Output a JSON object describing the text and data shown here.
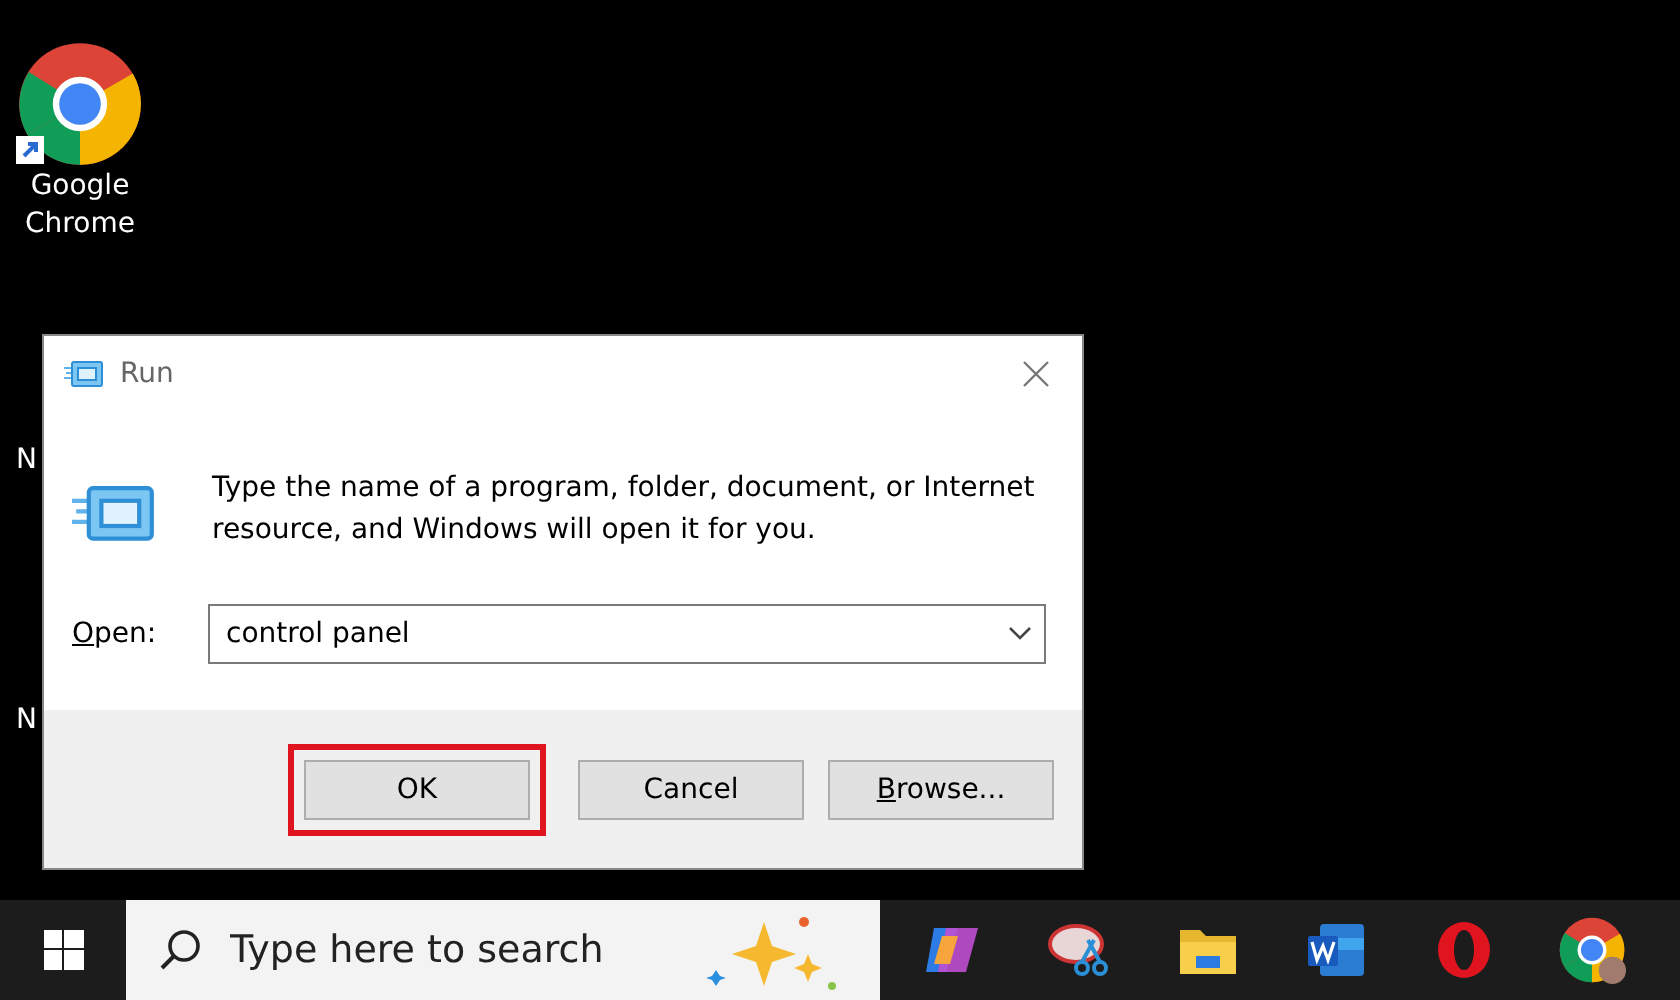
{
  "desktop_icons": [
    {
      "kind": "chrome",
      "label": "Google Chrome"
    },
    {
      "kind": "partial",
      "label": "N"
    },
    {
      "kind": "partial",
      "label": "N"
    }
  ],
  "dialog": {
    "title": "Run",
    "message": "Type the name of a program, folder, document, or Internet resource, and Windows will open it for you.",
    "open_label": {
      "key": "O",
      "rest": "pen:"
    },
    "open_value": "control panel",
    "buttons": [
      {
        "label": {
          "rest": "OK"
        },
        "highlighted": true
      },
      {
        "label": {
          "rest": "Cancel"
        },
        "highlighted": false
      },
      {
        "label": {
          "key": "B",
          "rest": "rowse..."
        },
        "highlighted": false
      }
    ]
  },
  "taskbar": {
    "search_placeholder": "Type here to search",
    "apps": [
      {
        "kind": "copilot"
      },
      {
        "kind": "snip"
      },
      {
        "kind": "folder"
      },
      {
        "kind": "word"
      },
      {
        "kind": "opera"
      },
      {
        "kind": "chrome"
      }
    ]
  }
}
